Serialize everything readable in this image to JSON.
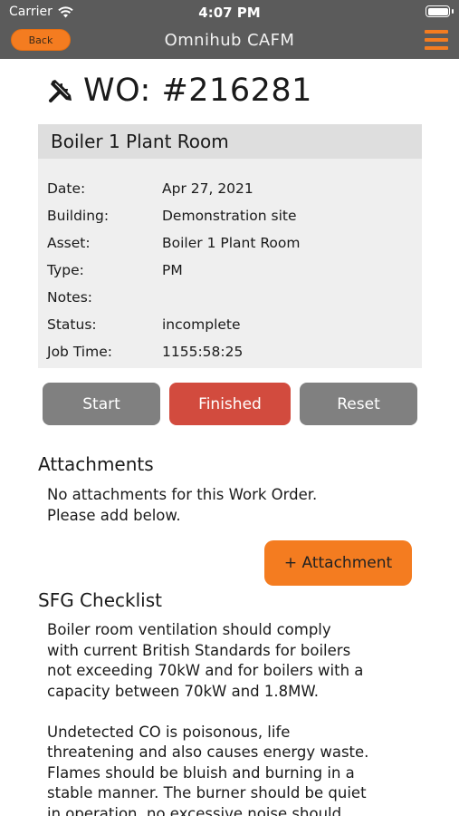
{
  "status_bar": {
    "carrier": "Carrier",
    "time": "4:07 PM"
  },
  "nav": {
    "back_label": "Back",
    "title": "Omnihub CAFM"
  },
  "work_order": {
    "title": "WO: #216281"
  },
  "card": {
    "heading": "Boiler 1 Plant Room",
    "rows": [
      {
        "label": "Date:",
        "value": "Apr 27, 2021"
      },
      {
        "label": "Building:",
        "value": "Demonstration site"
      },
      {
        "label": "Asset:",
        "value": "Boiler 1 Plant Room"
      },
      {
        "label": "Type:",
        "value": "PM"
      },
      {
        "label": "Notes:",
        "value": ""
      },
      {
        "label": "Status:",
        "value": "incomplete"
      },
      {
        "label": "Job Time:",
        "value": "1155:58:25"
      }
    ]
  },
  "actions": {
    "start": "Start",
    "finished": "Finished",
    "reset": "Reset"
  },
  "attachments": {
    "title": "Attachments",
    "empty_line1": "No attachments for this Work Order.",
    "empty_line2": "Please add below.",
    "add_button": "+ Attachment"
  },
  "checklist": {
    "title": "SFG Checklist",
    "lines": [
      "Boiler room ventilation should comply",
      "with current British Standards for boilers",
      "not exceeding 70kW and for boilers with a",
      "capacity between 70kW and 1.8MW.",
      "",
      "Undetected CO is poisonous, life",
      "threatening and also causes energy waste.",
      "Flames should be bluish and burning in a",
      "stable manner. The burner should be quiet",
      "in operation, no excessive noise should"
    ]
  },
  "colors": {
    "header": "#5b5b5b",
    "accent": "#f47c20",
    "finished": "#d24b3e",
    "neutral_button": "#808080"
  },
  "icons": {
    "tool": "wrench-screwdriver-icon",
    "wifi": "wifi-icon",
    "battery": "battery-icon",
    "menu": "hamburger-menu-icon"
  }
}
